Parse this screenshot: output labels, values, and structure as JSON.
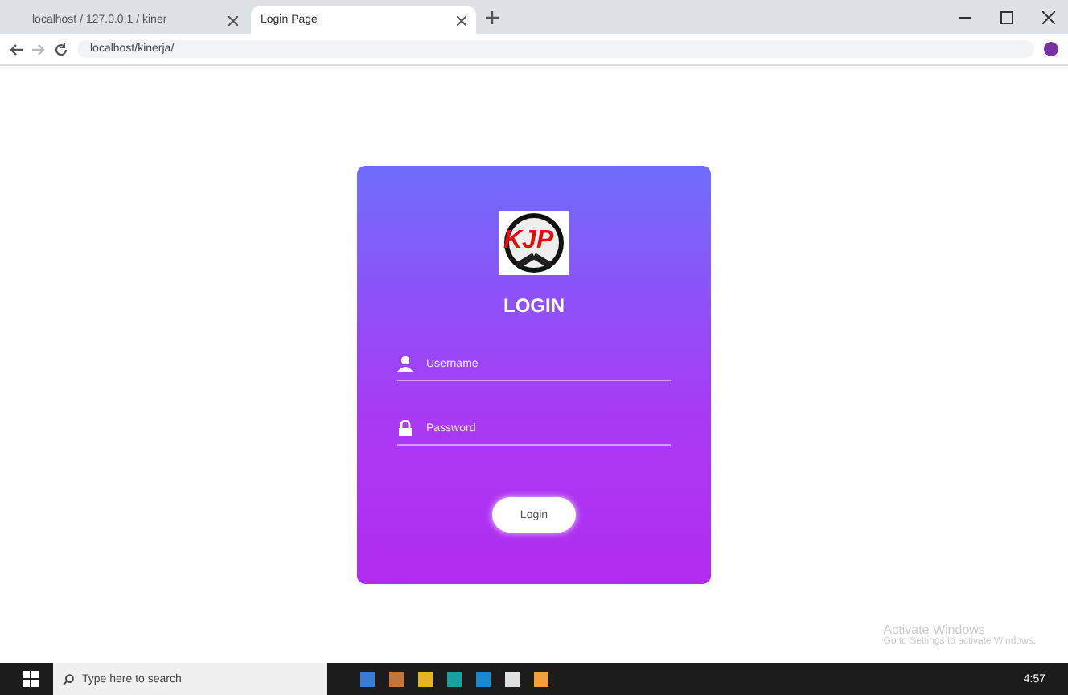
{
  "browser": {
    "tabs": [
      {
        "title": "localhost / 127.0.0.1 / kiner",
        "selected": false
      },
      {
        "title": "Login Page",
        "selected": true
      }
    ],
    "url": "localhost/kinerja/"
  },
  "login": {
    "logo_text": "KJP",
    "title": "LOGIN",
    "fields": [
      {
        "kind": "user",
        "placeholder": "Username"
      },
      {
        "kind": "lock",
        "placeholder": "Password"
      }
    ],
    "button": "Login"
  },
  "watermark_notice": {
    "title": "Activate Windows",
    "subtitle": "Go to Settings to activate Windows."
  },
  "taskbar": {
    "search_placeholder": "Type here to search",
    "time": "4:57"
  }
}
